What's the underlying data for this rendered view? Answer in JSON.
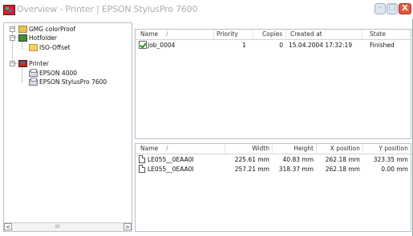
{
  "window": {
    "title": "Overview - Printer | EPSON StylusPro 7600",
    "minimize": "–",
    "maximize": "□",
    "close": "X"
  },
  "tree": {
    "collapse_symbol": "−",
    "nodes": [
      {
        "label": "GMG colorProof",
        "icon": "folder-icon"
      },
      {
        "label": "Hotfolder",
        "icon": "hotfolder-icon"
      },
      {
        "label": "ISO-Offset",
        "icon": "folder-icon"
      },
      {
        "label": "Printer",
        "icon": "printer-icon"
      },
      {
        "label": "EPSON 4000",
        "icon": "printer-device-icon"
      },
      {
        "label": "EPSON StylusPro 7600",
        "icon": "printer-device-icon"
      }
    ],
    "scroll_left": "<",
    "scroll_right": ">",
    "scroll_grip": "III"
  },
  "jobs": {
    "headers": {
      "name": "Name",
      "sort": "/",
      "priority": "Priority",
      "copies": "Copies",
      "created": "Created at",
      "state": "State"
    },
    "rows": [
      {
        "name": "Job_0004",
        "priority": "1",
        "copies": "0",
        "created": "15.04.2004 17:32:19",
        "state": "Finished"
      }
    ]
  },
  "pages": {
    "headers": {
      "name": "Name",
      "sort": "/",
      "width": "Width",
      "height": "Height",
      "xpos": "X position",
      "ypos": "Y position"
    },
    "rows": [
      {
        "name": "LE055__0EAA0I",
        "width": "225.61 mm",
        "height": "40.83 mm",
        "xpos": "262.18 mm",
        "ypos": "323.35 mm"
      },
      {
        "name": "LE055__0EAA0I",
        "width": "257.21 mm",
        "height": "318.37 mm",
        "xpos": "262.18 mm",
        "ypos": "0.00 mm"
      }
    ]
  }
}
